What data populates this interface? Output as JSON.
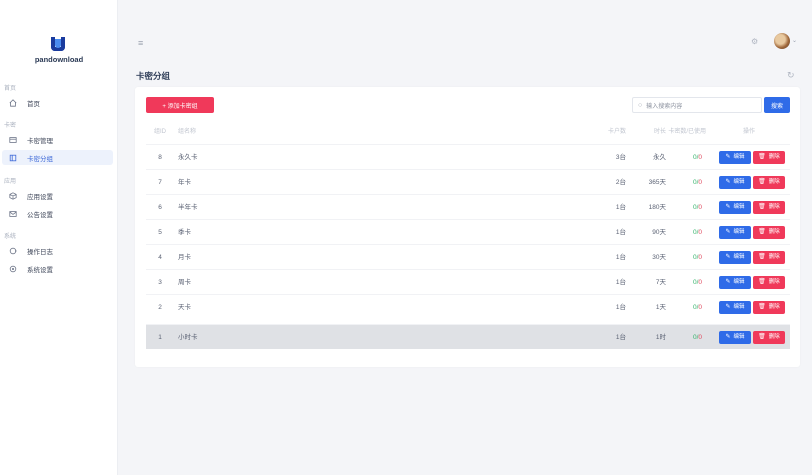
{
  "brand": {
    "name": "pandownload"
  },
  "sidebar": {
    "sections": [
      {
        "title": "首页",
        "items": [
          {
            "label": "首页",
            "icon": "home-icon"
          }
        ]
      },
      {
        "title": "卡密",
        "items": [
          {
            "label": "卡密管理",
            "icon": "card-icon"
          },
          {
            "label": "卡密分组",
            "icon": "group-icon",
            "active": true
          }
        ]
      },
      {
        "title": "应用",
        "items": [
          {
            "label": "应用设置",
            "icon": "cube-icon"
          },
          {
            "label": "公告设置",
            "icon": "mail-icon"
          }
        ]
      },
      {
        "title": "系统",
        "items": [
          {
            "label": "操作日志",
            "icon": "log-icon"
          },
          {
            "label": "系统设置",
            "icon": "settings-icon"
          }
        ]
      }
    ]
  },
  "header": {
    "menu_icon": "≡",
    "settings_icon": "⚙",
    "avatar_caret": "⌄"
  },
  "page": {
    "title": "卡密分组",
    "refresh_icon": "↻"
  },
  "toolbar": {
    "add_label": "+ 添加卡密组",
    "search_placeholder": "输入搜索内容",
    "search_label": "搜索"
  },
  "table": {
    "columns": {
      "id": "组ID",
      "name": "组名称",
      "cards": "卡户数",
      "duration": "时长",
      "status": "卡密数/已使用",
      "ops": "操作"
    },
    "rows": [
      {
        "id": "8",
        "name": "永久卡",
        "cards": "3台",
        "duration": "永久",
        "active": "0",
        "sep": "/",
        "used": "0"
      },
      {
        "id": "7",
        "name": "年卡",
        "cards": "2台",
        "duration": "365天",
        "active": "0",
        "sep": "/",
        "used": "0"
      },
      {
        "id": "6",
        "name": "半年卡",
        "cards": "1台",
        "duration": "180天",
        "active": "0",
        "sep": "/",
        "used": "0"
      },
      {
        "id": "5",
        "name": "季卡",
        "cards": "1台",
        "duration": "90天",
        "active": "0",
        "sep": "/",
        "used": "0"
      },
      {
        "id": "4",
        "name": "月卡",
        "cards": "1台",
        "duration": "30天",
        "active": "0",
        "sep": "/",
        "used": "0"
      },
      {
        "id": "3",
        "name": "周卡",
        "cards": "1台",
        "duration": "7天",
        "active": "0",
        "sep": "/",
        "used": "0"
      },
      {
        "id": "2",
        "name": "天卡",
        "cards": "1台",
        "duration": "1天",
        "active": "0",
        "sep": "/",
        "used": "0"
      },
      {
        "id": "1",
        "name": "小时卡",
        "cards": "1台",
        "duration": "1时",
        "active": "0",
        "sep": "/",
        "used": "0"
      }
    ],
    "edit_label": "编辑",
    "edit_icon": "✎",
    "delete_label": "删除",
    "delete_icon": "🗑"
  },
  "colors": {
    "primary": "#2f6be8",
    "danger": "#f0395a",
    "success": "#35b36b",
    "brand": "#1a3b9e"
  }
}
